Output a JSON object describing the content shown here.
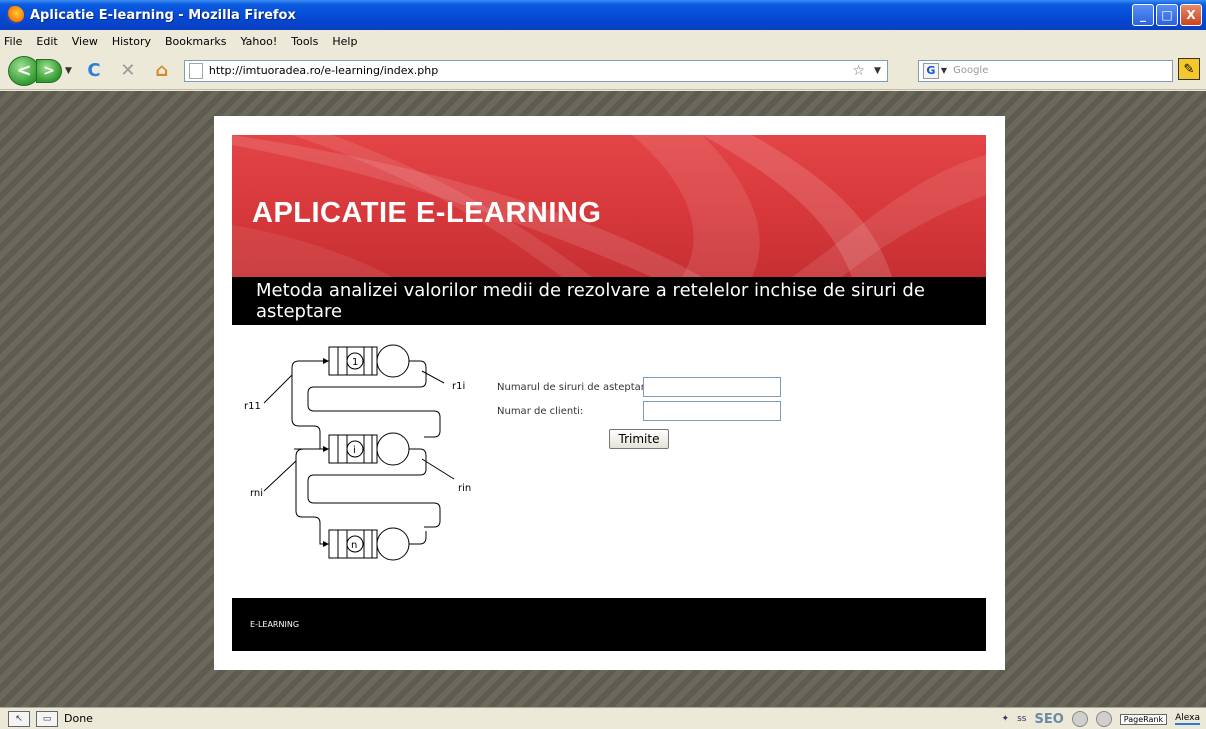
{
  "window": {
    "title": "Aplicatie E-learning - Mozilla Firefox",
    "buttons": {
      "minimize": "_",
      "maximize": "□",
      "close": "X"
    }
  },
  "menu": {
    "items": [
      "File",
      "Edit",
      "View",
      "History",
      "Bookmarks",
      "Yahoo!",
      "Tools",
      "Help"
    ]
  },
  "nav": {
    "back_label": "<",
    "forward_label": ">",
    "reload_glyph": "C",
    "stop_glyph": "✕",
    "home_glyph": "⌂",
    "url": "http://imtuoradea.ro/e-learning/index.php",
    "search_placeholder": "Google",
    "search_engine_glyph": "G"
  },
  "page": {
    "banner_title": "APLICATIE E-LEARNING",
    "subtitle": "Metoda analizei valorilor medii de rezolvare a retelelor inchise de siruri de asteptare",
    "diagram_labels": {
      "station_1": "1",
      "station_i": "i",
      "station_n": "n",
      "r11": "r11",
      "r1i": "r1i",
      "rni": "rni",
      "rin": "rin"
    },
    "form": {
      "queues_label": "Numarul de siruri de asteptare:",
      "queues_value": "",
      "clients_label": "Numar de clienti:",
      "clients_value": "",
      "submit_label": "Trimite"
    },
    "footer_text": "E-LEARNING"
  },
  "status": {
    "text": "Done",
    "pagerank_label": "PageRank",
    "alexa_label": "Alexa",
    "seo_label": "SEO",
    "ss_label": "ss"
  },
  "colors": {
    "banner_red": "#d8393c",
    "bar_black": "#000000",
    "background_stripe": "#5e5b50"
  }
}
